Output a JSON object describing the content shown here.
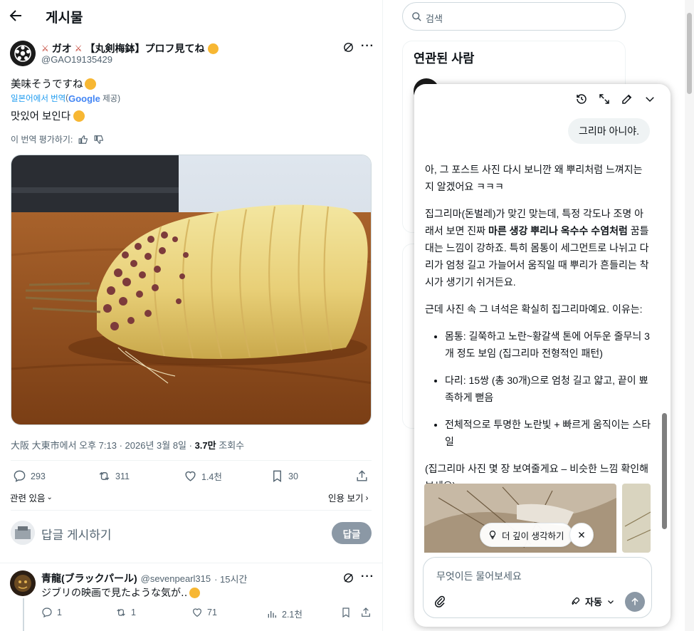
{
  "header": {
    "title": "게시물"
  },
  "post": {
    "author_name": "【丸剣梅鉢】プロフ見てね",
    "author_prefix": "ガオ",
    "author_handle": "@GAO19135429",
    "text_original": "美味そうですね",
    "translated_from": "일본어에서 번역",
    "google_label": "Google",
    "provided": "제공)",
    "text_translated": "맛있어 보인다",
    "rate_translation": "이 번역 평가하기:",
    "meta_location_time": "大阪 大東市에서 오후 7:13 · 2026년 3월 8일 · ",
    "meta_views": "3.7만",
    "meta_views_label": " 조회수",
    "stats": {
      "replies": "293",
      "reposts": "311",
      "likes": "1.4천",
      "bookmarks": "30"
    },
    "related_label": "관련 있음",
    "quotes_label": "인용 보기",
    "reply_placeholder": "답글 게시하기",
    "reply_button": "답글"
  },
  "reply": {
    "name": "青龍(ブラックパール)",
    "handle": "@sevenpearl315",
    "time": "· 15시간",
    "text": "ジブリの映画で見たような気が‥",
    "stats": {
      "replies": "1",
      "reposts": "1",
      "likes": "71",
      "views": "2.1천"
    }
  },
  "sidebar": {
    "search_placeholder": "검색",
    "related_title": "연관된 사람"
  },
  "chat": {
    "user_message": "그리마 아니야.",
    "p1": "아, 그 포스트 사진 다시 보니깐 왜 뿌리처럼 느껴지는지 알겠어요 ㅋㅋㅋ",
    "p2a": "집그리마(돈벌레)가 맞긴 맞는데, 특정 각도나 조명 아래서 보면 진짜 ",
    "p2b": "마른 생강 뿌리나 옥수수 수염처럼",
    "p2c": " 꿈틀대는 느낌이 강하죠. 특히 몸통이 세그먼트로 나뉘고 다리가 엄청 길고 가늘어서 움직일 때 뿌리가 흔들리는 착시가 생기기 쉬거든요.",
    "p3": "근데 사진 속 그 녀석은 확실히 집그리마예요. 이유는:",
    "bullets": [
      "몸통: 길쭉하고 노란~황갈색 톤에 어두운 줄무늬 3개 정도 보임 (집그리마 전형적인 패턴)",
      "다리: 15쌍 (총 30개)으로 엄청 길고 얇고, 끝이 뾰족하게 뻗음",
      "전체적으로 투명한 노란빛 + 빠르게 움직이는 스타일"
    ],
    "p4": "(집그리마 사진 몇 장 보여줄게요 – 비슷한 느낌 확인해보세요)",
    "deep_think": "더 깊이 생각하기",
    "input_placeholder": "무엇이든 물어보세요",
    "mode_label": "자동"
  }
}
